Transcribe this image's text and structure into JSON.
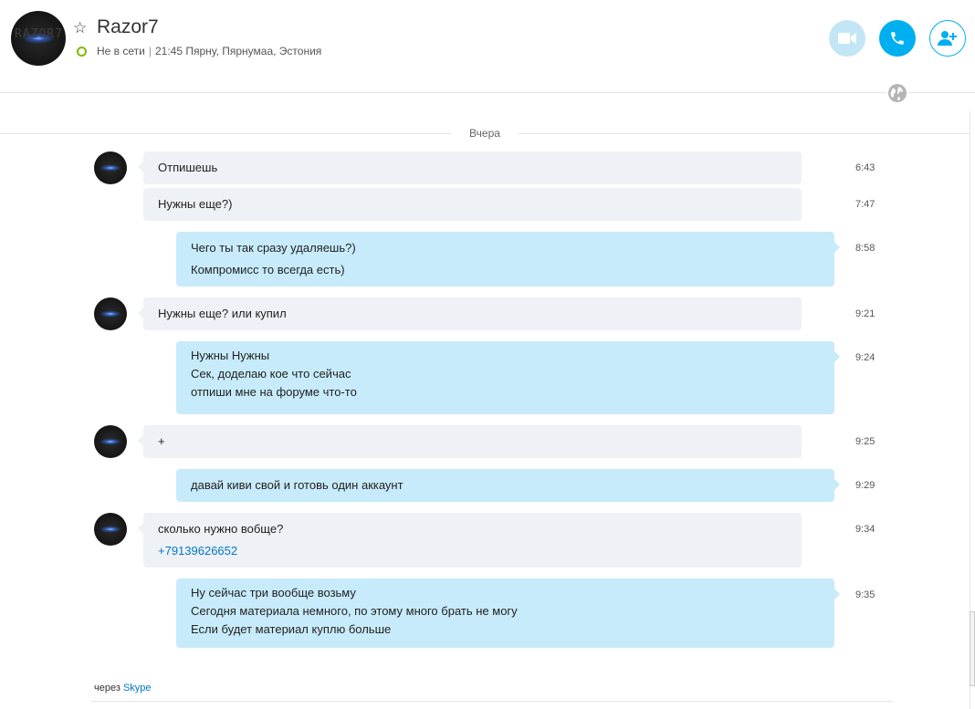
{
  "header": {
    "avatar_text": "RAZOR7",
    "contact_name": "Razor7",
    "status": "Не в сети",
    "status_separator": "|",
    "local_info": "21:45 Пярну, Пярнумаа, Эстония",
    "buttons": {
      "video_icon": "video-camera-icon",
      "call_icon": "phone-icon",
      "add_icon": "add-contact-icon"
    },
    "accent_color": "#00aff0",
    "status_color": "#7fba00"
  },
  "date_divider": "Вчера",
  "messages": [
    {
      "dir": "in",
      "avatar": true,
      "lines": [
        "Отпишешь"
      ],
      "time": "6:43"
    },
    {
      "dir": "in",
      "avatar": false,
      "lines": [
        "Нужны еще?)"
      ],
      "time": "7:47"
    },
    {
      "dir": "out",
      "lines": [
        "Чего ты так сразу удаляешь?)",
        "Компромисс то всегда есть)"
      ],
      "time": "8:58"
    },
    {
      "dir": "in",
      "avatar": true,
      "lines": [
        "Нужны еще? или купил"
      ],
      "time": "9:21"
    },
    {
      "dir": "out",
      "lines": [
        "Нужны Нужны",
        "Сек, доделаю кое что сейчас",
        "отпиши мне на форуме что-то"
      ],
      "time": "9:24"
    },
    {
      "dir": "in",
      "avatar": true,
      "lines": [
        "+"
      ],
      "time": "9:25"
    },
    {
      "dir": "out",
      "lines": [
        "давай киви свой и готовь один аккаунт"
      ],
      "time": "9:29"
    },
    {
      "dir": "in",
      "avatar": true,
      "lines": [
        "сколько нужно вобще?"
      ],
      "link": "+79139626652",
      "time": "9:34"
    },
    {
      "dir": "out",
      "lines": [
        "Ну сейчас три вообще возьму",
        "Сегодня материала немного, по этому много брать не могу",
        "Если будет материал куплю больше"
      ],
      "time": "9:35"
    }
  ],
  "footer": {
    "via_text": "через",
    "via_link": "Skype"
  }
}
